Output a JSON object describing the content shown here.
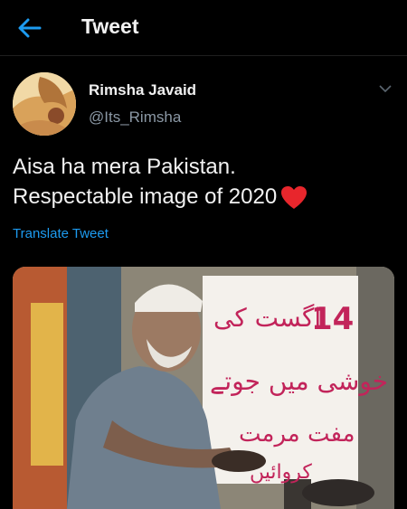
{
  "header": {
    "title": "Tweet",
    "back_icon": "arrow-left-icon",
    "accent": "#1d9bf0"
  },
  "tweet": {
    "author": {
      "display_name": "Rimsha Javaid",
      "handle": "@Its_Rimsha",
      "avatar_icon": "avatar"
    },
    "text_line1": "Aisa ha mera Pakistan.",
    "text_line2": "Respectable image of 2020",
    "emoji_icon": "red-heart-icon",
    "translate_label": "Translate Tweet",
    "media": {
      "sign_number": "14",
      "sign_line1": "اگست کی",
      "sign_line2": "خوشی میں جوتے",
      "sign_line3": "مفت مرمت",
      "sign_line4": "کروائیں"
    }
  }
}
